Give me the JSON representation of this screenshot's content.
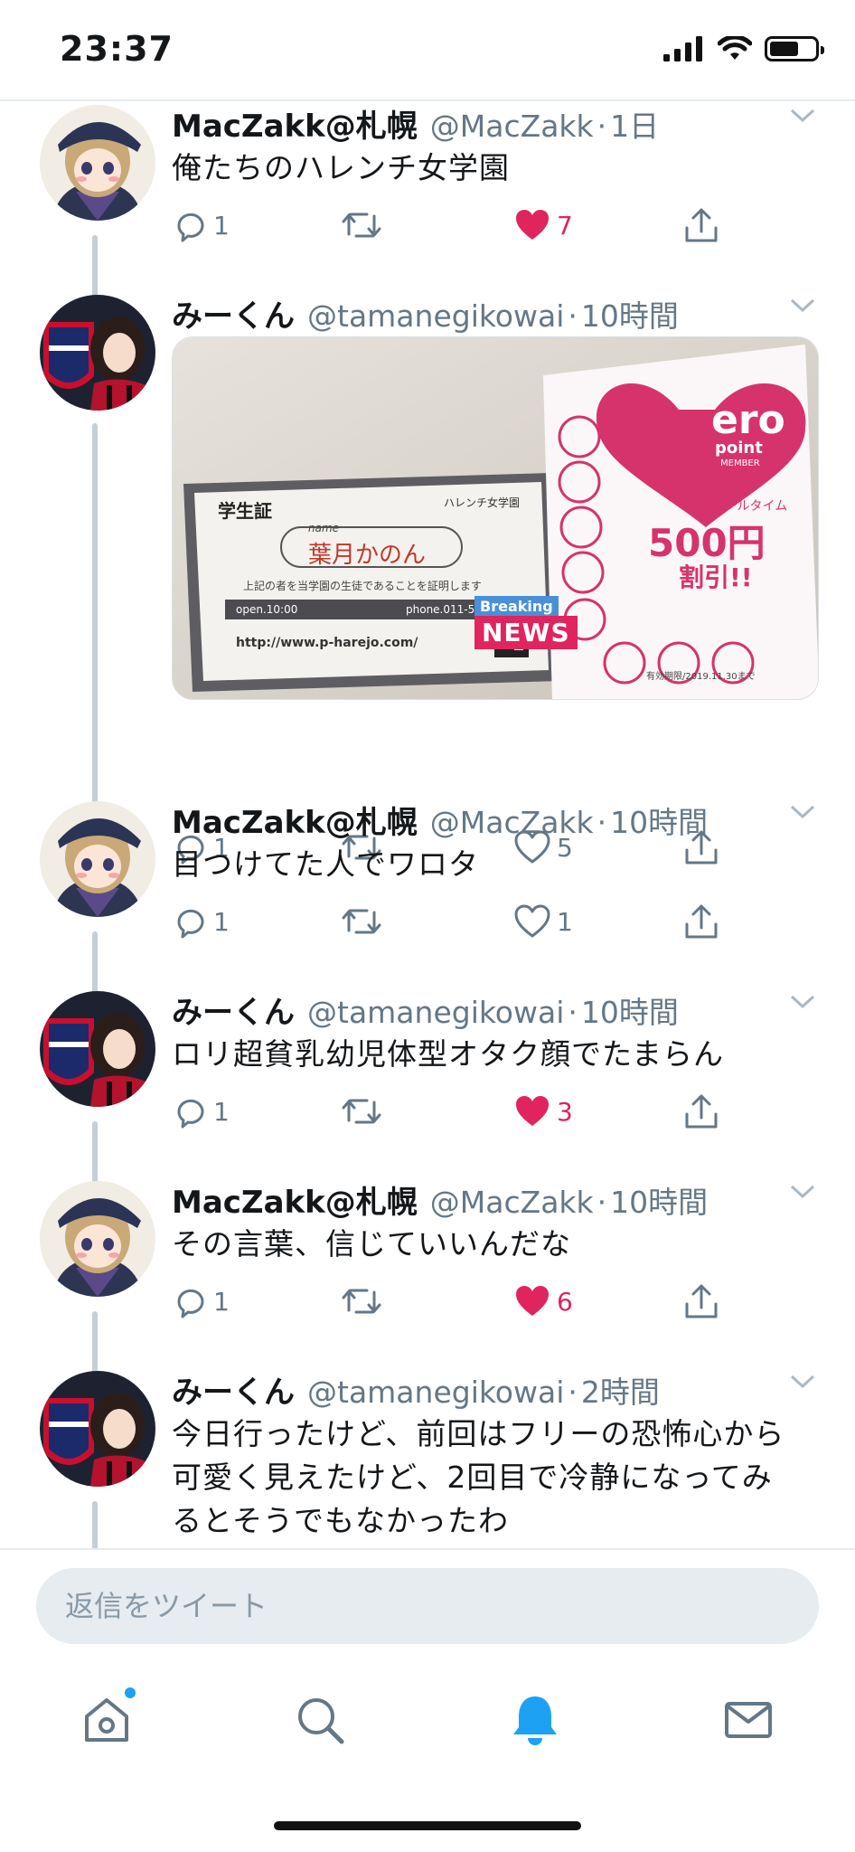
{
  "status": {
    "time": "23:37"
  },
  "tweets": [
    {
      "name": "MacZakk@札幌",
      "handle": "@MacZakk",
      "time": "1日",
      "text": "俺たちのハレンチ女学園",
      "replies": "1",
      "likes": "7",
      "liked": true
    },
    {
      "name": "みーくん",
      "handle": "@tamanegikowai",
      "time": "10時間",
      "text": "",
      "replies": "1",
      "likes": "5",
      "liked": false,
      "media": {
        "card_title": "学生証",
        "card_school": "ハレンチ女学園",
        "card_name_label": "name",
        "card_name": "葉月かのん",
        "card_statement": "上記の者を当学園の生徒であることを証明します",
        "card_open": "open.10:00",
        "card_phone": "phone.011-520-0959",
        "card_url": "http://www.p-harejo.com/",
        "breaking_label": "Breaking",
        "news_label": "NEWS",
        "flyer_brand": "ero",
        "flyer_point": "point",
        "flyer_member": "MEMBER",
        "flyer_alltime": "♥オールタイム",
        "flyer_price": "500円",
        "flyer_discount": "割引!!",
        "flyer_expiry": "有効期限/2019.11.30まで"
      }
    },
    {
      "name": "MacZakk@札幌",
      "handle": "@MacZakk",
      "time": "10時間",
      "text": "目つけてた人でワロタ",
      "replies": "1",
      "likes": "1",
      "liked": false
    },
    {
      "name": "みーくん",
      "handle": "@tamanegikowai",
      "time": "10時間",
      "text": "ロリ超貧乳幼児体型オタク顔でたまらん",
      "replies": "1",
      "likes": "3",
      "liked": true
    },
    {
      "name": "MacZakk@札幌",
      "handle": "@MacZakk",
      "time": "10時間",
      "text": "その言葉、信じていいんだな",
      "replies": "1",
      "likes": "6",
      "liked": true
    },
    {
      "name": "みーくん",
      "handle": "@tamanegikowai",
      "time": "2時間",
      "text_lines": [
        "今日行ったけど、前回はフリーの恐怖心から",
        "可愛く見えたけど、2回目で冷静になってみ",
        "るとそうでもなかったわ"
      ]
    }
  ],
  "composer": {
    "placeholder": "返信をツイート"
  },
  "colors": {
    "accent": "#1da1f2",
    "like": "#e0245e",
    "muted": "#657786"
  },
  "icons": [
    "reply-icon",
    "retweet-icon",
    "heart-icon",
    "share-icon",
    "home-icon",
    "search-icon",
    "bell-icon",
    "mail-icon"
  ]
}
